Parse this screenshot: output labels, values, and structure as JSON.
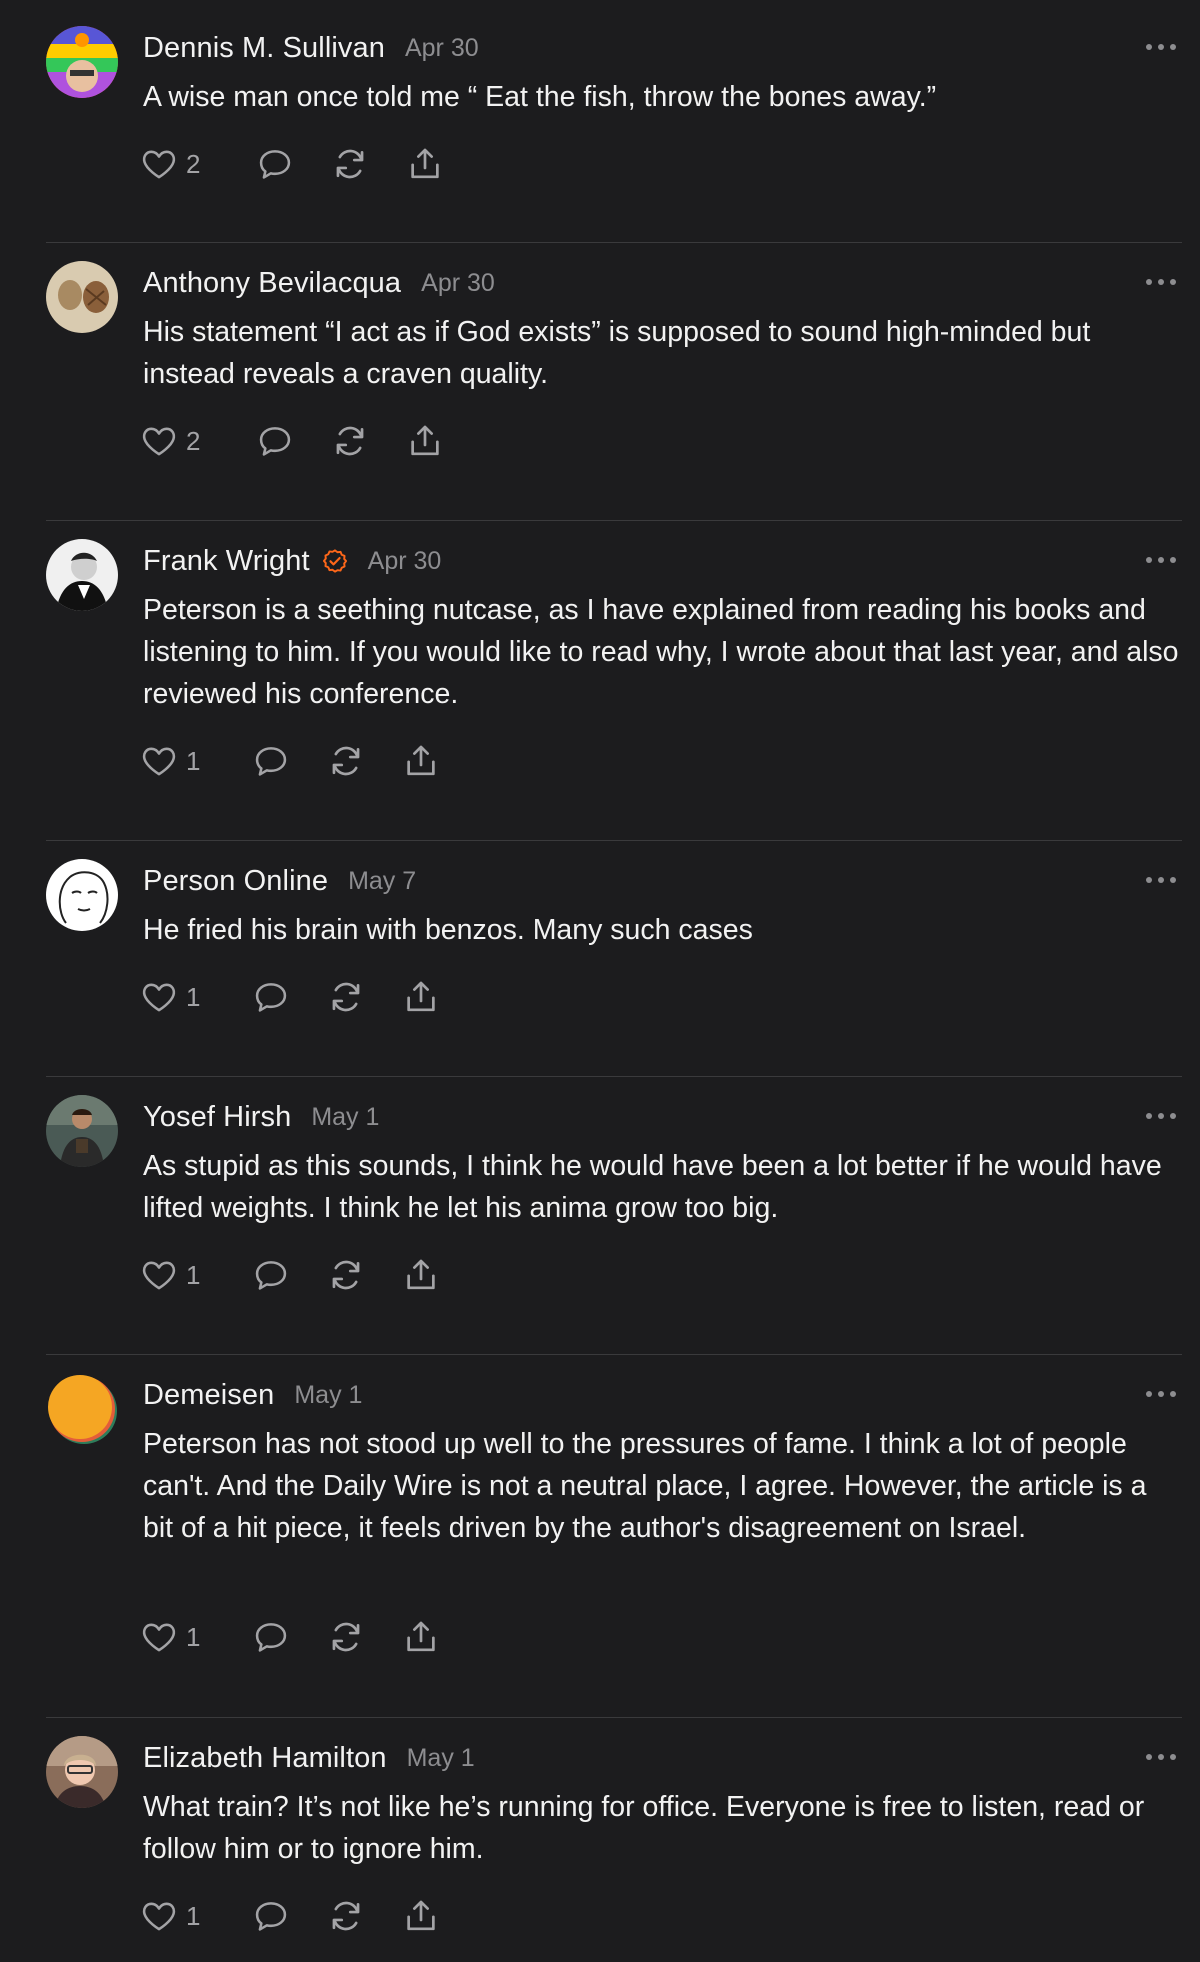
{
  "comments": [
    {
      "author": "Dennis M. Sullivan",
      "date": "Apr 30",
      "verified": false,
      "avatar_icon": "colorful-avatar",
      "text": "A wise man once told me “ Eat the fish, throw the bones away.”",
      "likes": "2"
    },
    {
      "author": "Anthony Bevilacqua",
      "date": "Apr 30",
      "verified": false,
      "avatar_icon": "pinecone-avatar",
      "text": "His statement “I act as if God exists” is supposed to sound high-minded but instead reveals a craven quality.",
      "likes": "2"
    },
    {
      "author": "Frank Wright",
      "date": "Apr 30",
      "verified": true,
      "avatar_icon": "portrait-avatar",
      "text": "Peterson is a seething nutcase, as I have explained from reading his books and listening to him. If you would like to read why, I wrote about that last year, and also reviewed his conference.",
      "likes": "1"
    },
    {
      "author": "Person Online",
      "date": "May 7",
      "verified": false,
      "avatar_icon": "wojak-avatar",
      "text": "He fried his brain with benzos. Many such cases",
      "likes": "1"
    },
    {
      "author": "Yosef Hirsh",
      "date": "May 1",
      "verified": false,
      "avatar_icon": "photo-avatar",
      "text": "As stupid as this sounds, I think he would have been a lot better if he would have lifted weights. I think he let his anima grow too big.",
      "likes": "1"
    },
    {
      "author": "Demeisen",
      "date": "May 1",
      "verified": false,
      "avatar_icon": "orange-circle-avatar",
      "text": "Peterson has not stood up well to the pressures of fame. I think a lot of people can't. And the Daily Wire is not a neutral place, I agree. However, the article is a bit of a hit piece, it feels driven by the author's disagreement on Israel.",
      "likes": "1"
    },
    {
      "author": "Elizabeth Hamilton",
      "date": "May 1",
      "verified": false,
      "avatar_icon": "selfie-avatar",
      "text": "What train? It’s not like he’s running for office. Everyone is free to listen, read or follow him or to ignore him.",
      "likes": "1"
    }
  ],
  "action_icons": [
    "heart-icon",
    "reply-icon",
    "restack-icon",
    "share-icon"
  ],
  "colors": {
    "background": "#1c1c1e",
    "text": "#f2f2f2",
    "muted": "#8d8d90",
    "divider": "#3a3a3c",
    "verified": "#ff6719"
  }
}
